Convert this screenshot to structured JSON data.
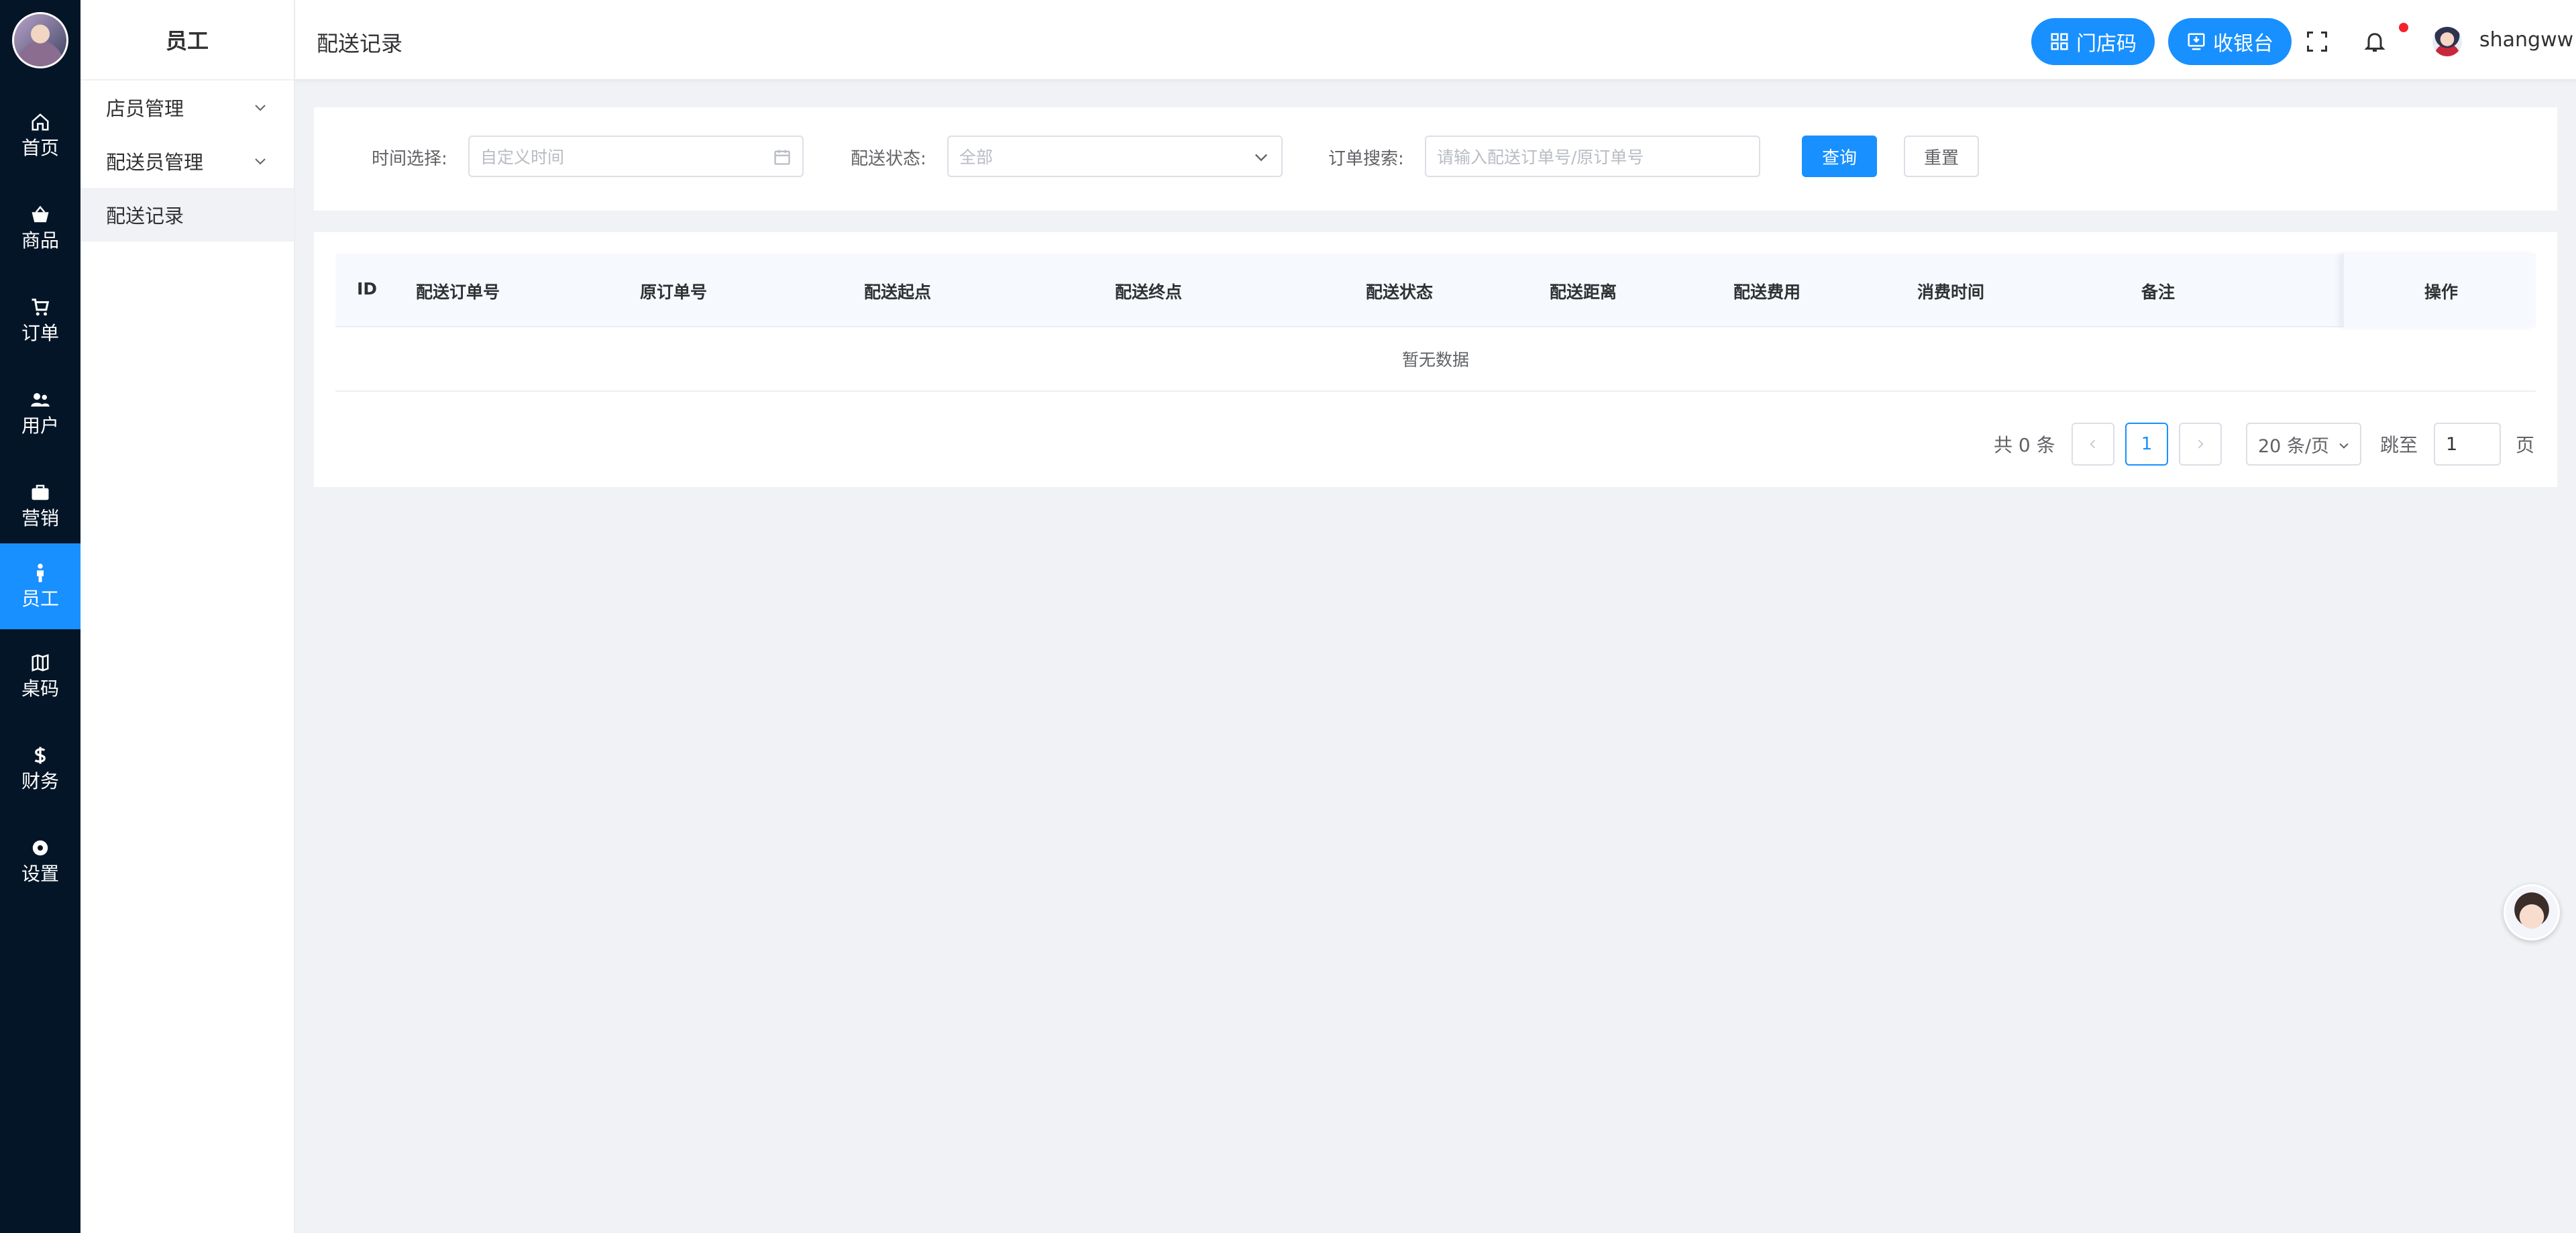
{
  "rail": {
    "items": [
      {
        "label": "首页",
        "icon": "home-icon"
      },
      {
        "label": "商品",
        "icon": "basket-icon"
      },
      {
        "label": "订单",
        "icon": "cart-icon"
      },
      {
        "label": "用户",
        "icon": "users-icon"
      },
      {
        "label": "营销",
        "icon": "briefcase-icon"
      },
      {
        "label": "员工",
        "icon": "person-icon",
        "active": true
      },
      {
        "label": "桌码",
        "icon": "map-icon"
      },
      {
        "label": "财务",
        "icon": "dollar-icon"
      },
      {
        "label": "设置",
        "icon": "gear-icon"
      }
    ]
  },
  "submenu": {
    "title": "员工",
    "items": [
      {
        "label": "店员管理",
        "expandable": true
      },
      {
        "label": "配送员管理",
        "expandable": true
      },
      {
        "label": "配送记录",
        "active": true
      }
    ]
  },
  "header": {
    "page_title": "配送记录",
    "store_code_button": "门店码",
    "cashier_button": "收银台",
    "username": "shangww"
  },
  "filters": {
    "time_label": "时间选择:",
    "time_placeholder": "自定义时间",
    "status_label": "配送状态:",
    "status_value": "全部",
    "search_label": "订单搜索:",
    "search_placeholder": "请输入配送订单号/原订单号",
    "query_button": "查询",
    "reset_button": "重置"
  },
  "table": {
    "columns": [
      "ID",
      "配送订单号",
      "原订单号",
      "配送起点",
      "配送终点",
      "配送状态",
      "配送距离",
      "配送费用",
      "消费时间",
      "备注",
      "操作"
    ],
    "empty_text": "暂无数据"
  },
  "pagination": {
    "total_text": "共 0 条",
    "current_page": "1",
    "page_size": "20 条/页",
    "jump_label": "跳至",
    "jump_value": "1",
    "page_suffix": "页"
  },
  "colors": {
    "rail_bg": "#041527",
    "accent": "#1890ff",
    "page_bg": "#f0f2f5",
    "notification_dot": "#f5222d"
  }
}
